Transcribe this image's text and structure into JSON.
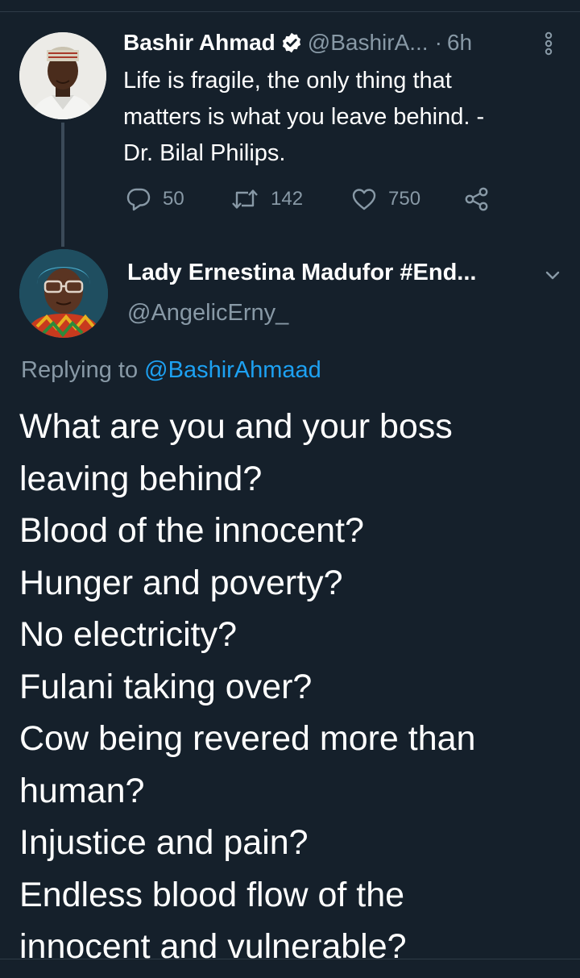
{
  "parent_tweet": {
    "author_name": "Bashir Ahmad",
    "handle": "@BashirA...",
    "separator": "·",
    "time": "6h",
    "verified": true,
    "text_lines": [
      "Life is fragile, the only thing that",
      "matters is what you leave behind. -",
      "Dr. Bilal Philips."
    ],
    "actions": {
      "reply_count": "50",
      "retweet_count": "142",
      "like_count": "750"
    }
  },
  "reply_tweet": {
    "author_name": "Lady Ernestina Madufor #End...",
    "handle": "@AngelicErny_",
    "replying_prefix": "Replying to",
    "replying_mention": "@BashirAhmaad",
    "text_lines": [
      "What are you and your boss",
      "leaving behind?",
      "Blood of the innocent?",
      "Hunger and poverty?",
      "No electricity?",
      "Fulani taking over?",
      "Cow being revered more than",
      "human?",
      "Injustice and pain?",
      "Endless blood flow of the",
      "innocent and vulnerable?"
    ]
  },
  "icons": {
    "verified": "verified-badge-icon",
    "more": "more-vertical-icon",
    "reply": "reply-icon",
    "retweet": "retweet-icon",
    "like": "heart-icon",
    "share": "share-icon",
    "caret": "chevron-down-icon"
  },
  "colors": {
    "background": "#15202b",
    "primary_text": "#ffffff",
    "secondary_text": "#8899a6",
    "accent": "#1da1f2",
    "divider": "#2f3b47"
  }
}
